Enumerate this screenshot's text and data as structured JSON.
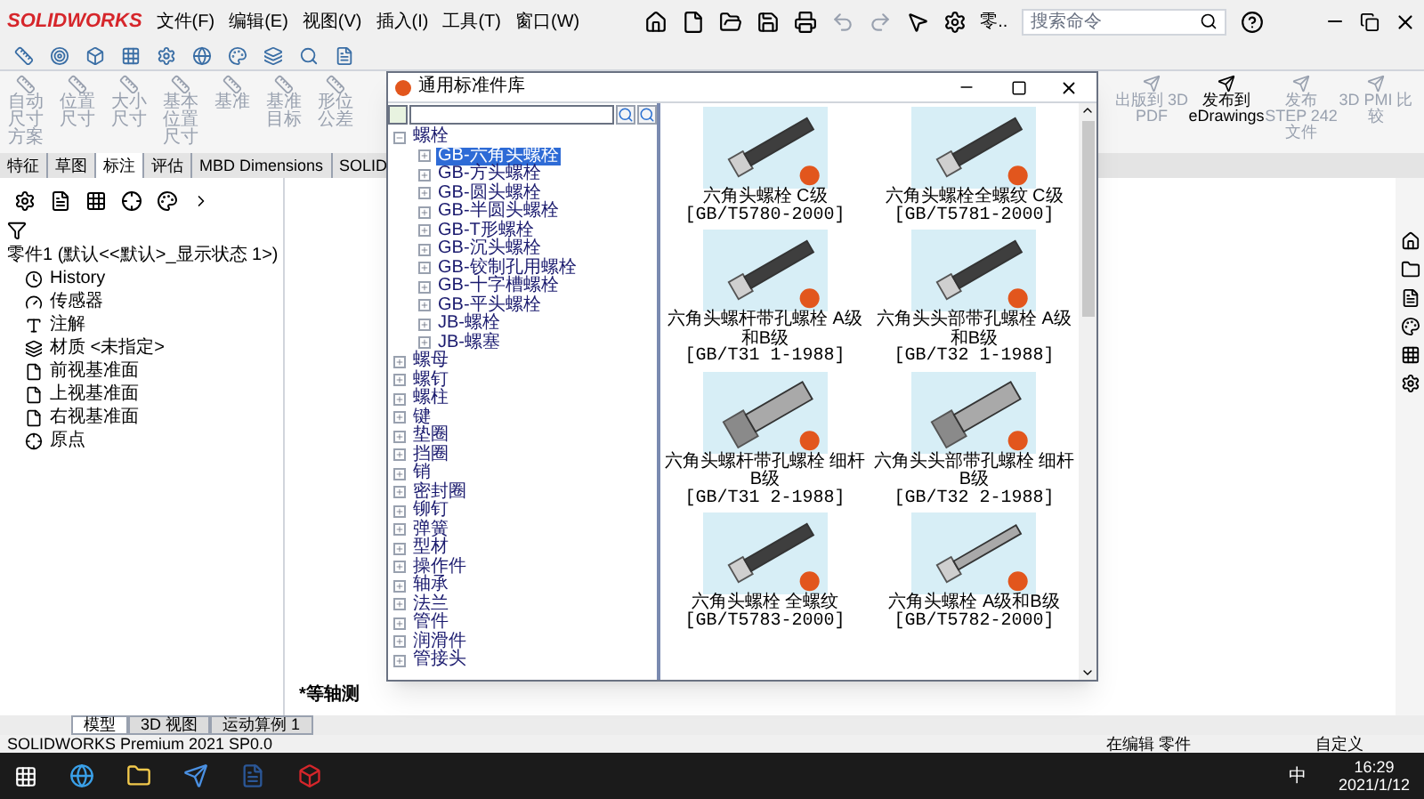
{
  "app": {
    "logo": "SOLIDWORKS",
    "menus": [
      "文件(F)",
      "编辑(E)",
      "视图(V)",
      "插入(I)",
      "工具(T)",
      "窗口(W)"
    ],
    "doc_label": "零..",
    "search": {
      "placeholder": "搜索命令"
    }
  },
  "ribbon": {
    "left_buttons": [
      {
        "label": "自动尺寸方案",
        "disabled": true
      },
      {
        "label": "位置尺寸",
        "disabled": true
      },
      {
        "label": "大小尺寸",
        "disabled": true
      },
      {
        "label": "基本位置尺寸",
        "disabled": true
      },
      {
        "label": "基准",
        "disabled": true
      },
      {
        "label": "基准目标",
        "disabled": true
      },
      {
        "label": "形位公差",
        "disabled": true
      }
    ],
    "right_buttons": [
      {
        "label": "出版到 3D PDF",
        "disabled": true
      },
      {
        "label": "发布到 eDrawings",
        "disabled": false
      },
      {
        "label": "发布 STEP 242 文件",
        "disabled": true
      },
      {
        "label": "3D PMI 比较",
        "disabled": true
      }
    ]
  },
  "tabs": [
    {
      "label": "特征",
      "selected": false
    },
    {
      "label": "草图",
      "selected": false
    },
    {
      "label": "标注",
      "selected": true
    },
    {
      "label": "评估",
      "selected": false
    },
    {
      "label": "MBD Dimensions",
      "selected": false
    },
    {
      "label": "SOLID",
      "selected": false
    }
  ],
  "feature_tree": {
    "root": "零件1 (默认<<默认>_显示状态 1>)",
    "items": [
      {
        "kind": "history",
        "label": "History"
      },
      {
        "kind": "sensor",
        "label": "传感器"
      },
      {
        "kind": "annotation",
        "label": "注解"
      },
      {
        "kind": "material",
        "label": "材质 <未指定>"
      },
      {
        "kind": "plane",
        "label": "前视基准面"
      },
      {
        "kind": "plane",
        "label": "上视基准面"
      },
      {
        "kind": "plane",
        "label": "右视基准面"
      },
      {
        "kind": "origin",
        "label": "原点"
      }
    ]
  },
  "view_label": "*等轴测",
  "bottom_tabs": [
    {
      "label": "模型",
      "selected": true
    },
    {
      "label": "3D 视图",
      "selected": false
    },
    {
      "label": "运动算例 1",
      "selected": false
    }
  ],
  "status_bar": {
    "product": "SOLIDWORKS Premium 2021 SP0.0",
    "mode": "在编辑 零件",
    "units": "自定义"
  },
  "taskbar": {
    "ime": "中",
    "time": "16:29",
    "date": "2021/1/12"
  },
  "dialog": {
    "title": "通用标准件库",
    "tree": [
      {
        "label": "螺栓",
        "expanded": true,
        "selected": false,
        "children": [
          {
            "label": "GB-六角头螺栓",
            "expanded": false,
            "selected": true
          },
          {
            "label": "GB-方头螺栓",
            "expanded": false,
            "selected": false
          },
          {
            "label": "GB-圆头螺栓",
            "expanded": false,
            "selected": false
          },
          {
            "label": "GB-半圆头螺栓",
            "expanded": false,
            "selected": false
          },
          {
            "label": "GB-T形螺栓",
            "expanded": false,
            "selected": false
          },
          {
            "label": "GB-沉头螺栓",
            "expanded": false,
            "selected": false
          },
          {
            "label": "GB-铰制孔用螺栓",
            "expanded": false,
            "selected": false
          },
          {
            "label": "GB-十字槽螺栓",
            "expanded": false,
            "selected": false
          },
          {
            "label": "GB-平头螺栓",
            "expanded": false,
            "selected": false
          },
          {
            "label": "JB-螺栓",
            "expanded": false,
            "selected": false
          },
          {
            "label": "JB-螺塞",
            "expanded": false,
            "selected": false
          }
        ]
      },
      {
        "label": "螺母",
        "expanded": false,
        "selected": false
      },
      {
        "label": "螺钉",
        "expanded": false,
        "selected": false
      },
      {
        "label": "螺柱",
        "expanded": false,
        "selected": false
      },
      {
        "label": "键",
        "expanded": false,
        "selected": false
      },
      {
        "label": "垫圈",
        "expanded": false,
        "selected": false
      },
      {
        "label": "挡圈",
        "expanded": false,
        "selected": false
      },
      {
        "label": "销",
        "expanded": false,
        "selected": false
      },
      {
        "label": "密封圈",
        "expanded": false,
        "selected": false
      },
      {
        "label": "铆钉",
        "expanded": false,
        "selected": false
      },
      {
        "label": "弹簧",
        "expanded": false,
        "selected": false
      },
      {
        "label": "型材",
        "expanded": false,
        "selected": false
      },
      {
        "label": "操作件",
        "expanded": false,
        "selected": false
      },
      {
        "label": "轴承",
        "expanded": false,
        "selected": false
      },
      {
        "label": "法兰",
        "expanded": false,
        "selected": false
      },
      {
        "label": "管件",
        "expanded": false,
        "selected": false
      },
      {
        "label": "润滑件",
        "expanded": false,
        "selected": false
      },
      {
        "label": "管接头",
        "expanded": false,
        "selected": false
      }
    ],
    "parts": [
      {
        "name": "六角头螺栓 C级",
        "standard": "[GB/T5780-2000]",
        "kind": "hex"
      },
      {
        "name": "六角头螺栓全螺纹 C级",
        "standard": "[GB/T5781-2000]",
        "kind": "hex"
      },
      {
        "name": "六角头螺杆带孔螺栓 A级和B级",
        "standard": "[GB/T31 1-1988]",
        "kind": "hex"
      },
      {
        "name": "六角头头部带孔螺栓 A级和B级",
        "standard": "[GB/T32 1-1988]",
        "kind": "hex"
      },
      {
        "name": "六角头螺杆带孔螺栓 细杆 B级",
        "standard": "[GB/T31 2-1988]",
        "kind": "thick"
      },
      {
        "name": "六角头头部带孔螺栓 细杆 B级",
        "standard": "[GB/T32 2-1988]",
        "kind": "thick"
      },
      {
        "name": "六角头螺栓 全螺纹",
        "standard": "[GB/T5783-2000]",
        "kind": "hex"
      },
      {
        "name": "六角头螺栓 A级和B级",
        "standard": "[GB/T5782-2000]",
        "kind": "thin"
      }
    ]
  }
}
